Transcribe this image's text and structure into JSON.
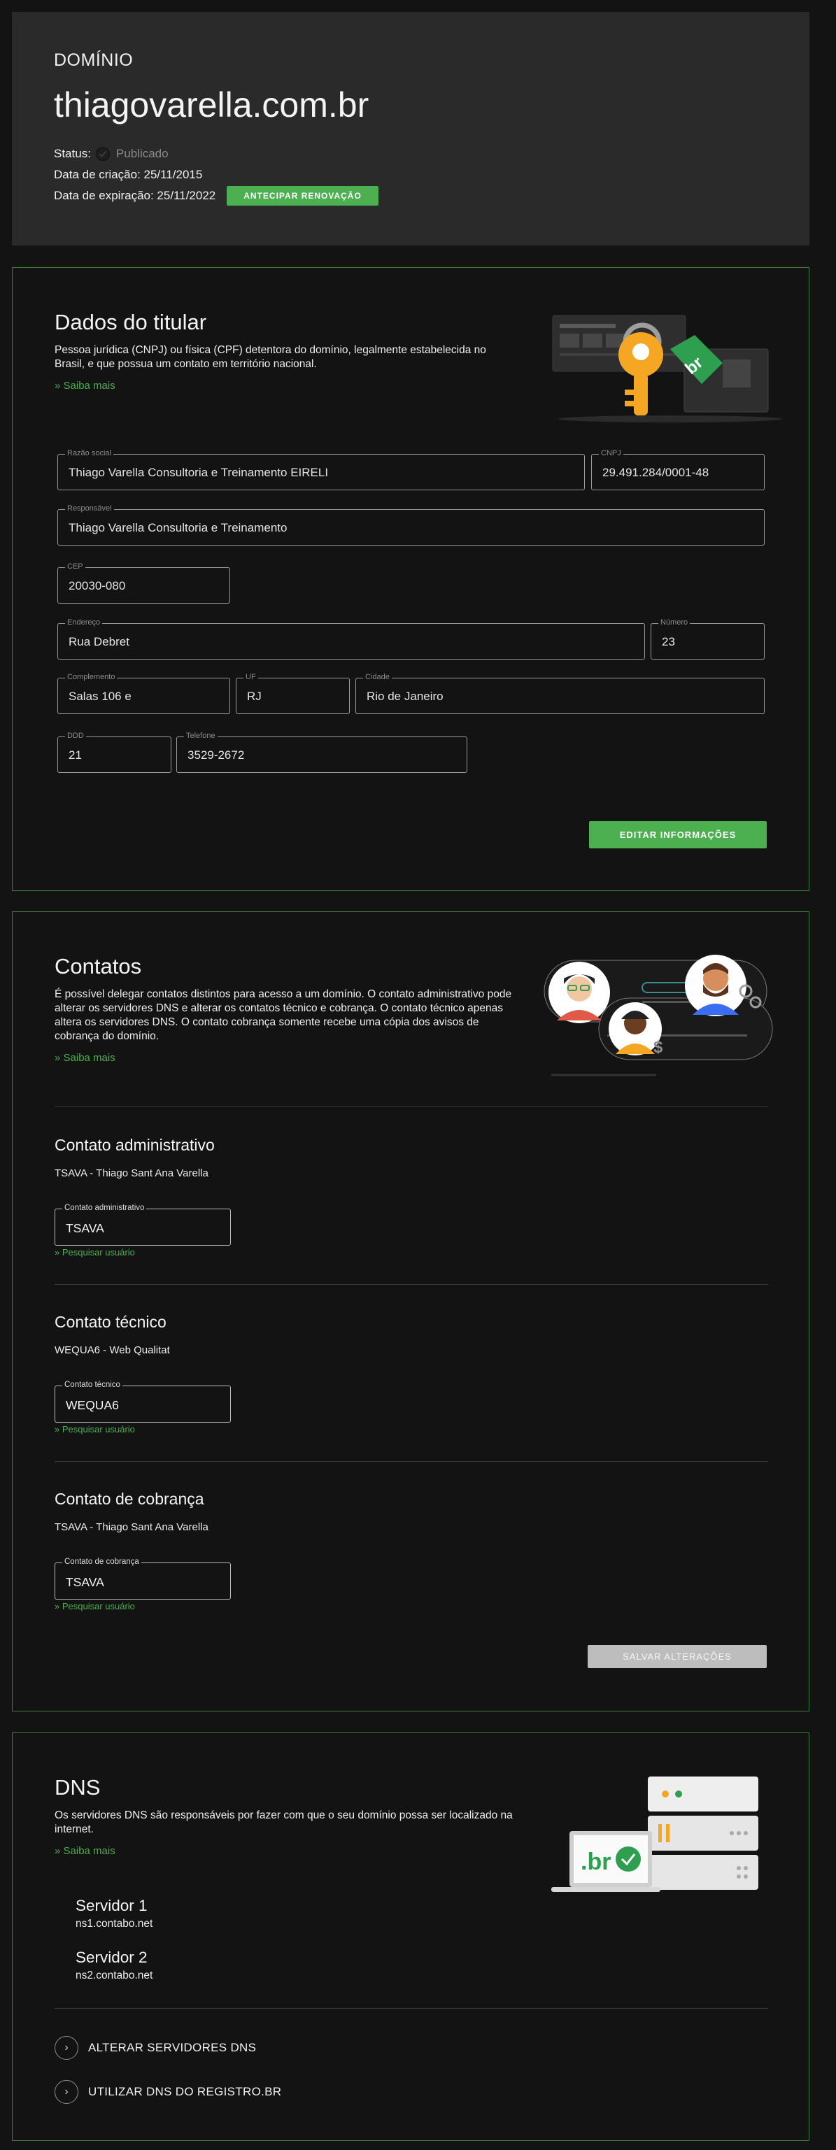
{
  "domain": {
    "eyebrow": "DOMÍNIO",
    "name": "thiagovarella.com.br",
    "status_label": "Status:",
    "status_value": "Publicado",
    "created_label": "Data de criação: 25/11/2015",
    "expires_label": "Data de expiração: 25/11/2022",
    "renew_button": "ANTECIPAR RENOVAÇÃO"
  },
  "holder": {
    "title": "Dados do titular",
    "description": "Pessoa jurídica (CNPJ) ou física (CPF) detentora do domínio, legalmente estabelecida no Brasil, e que possua um contato em território nacional.",
    "more_link": "» Saiba mais",
    "fields": {
      "razao_label": "Razão social",
      "razao_value": "Thiago Varella Consultoria e Treinamento EIRELI",
      "cnpj_label": "CNPJ",
      "cnpj_value": "29.491.284/0001-48",
      "resp_label": "Responsável",
      "resp_value": "Thiago Varella Consultoria e Treinamento",
      "cep_label": "CEP",
      "cep_value": "20030-080",
      "endereco_label": "Endereço",
      "endereco_value": "Rua Debret",
      "numero_label": "Número",
      "numero_value": "23",
      "complemento_label": "Complemento",
      "complemento_value": "Salas 106 e",
      "uf_label": "UF",
      "uf_value": "RJ",
      "cidade_label": "Cidade",
      "cidade_value": "Rio de Janeiro",
      "ddd_label": "DDD",
      "ddd_value": "21",
      "telefone_label": "Telefone",
      "telefone_value": "3529-2672"
    },
    "edit_button": "EDITAR INFORMAÇÕES"
  },
  "contacts": {
    "title": "Contatos",
    "description": "É possível delegar contatos distintos para acesso a um domínio. O contato administrativo pode alterar os servidores DNS e alterar os contatos técnico e cobrança. O contato técnico apenas altera os servidores DNS. O contato cobrança somente recebe uma cópia dos avisos de cobrança do domínio.",
    "more_link": "» Saiba mais",
    "admin": {
      "title": "Contato administrativo",
      "name": "TSAVA - Thiago Sant Ana Varella",
      "field_label": "Contato administrativo",
      "field_value": "TSAVA",
      "search": "» Pesquisar usuário"
    },
    "tech": {
      "title": "Contato técnico",
      "name": "WEQUA6 - Web Qualitat",
      "field_label": "Contato técnico",
      "field_value": "WEQUA6",
      "search": "» Pesquisar usuário"
    },
    "billing": {
      "title": "Contato de cobrança",
      "name": "TSAVA - Thiago Sant Ana Varella",
      "field_label": "Contato de cobrança",
      "field_value": "TSAVA",
      "search": "» Pesquisar usuário"
    },
    "save_button": "SALVAR ALTERAÇÕES"
  },
  "dns": {
    "title": "DNS",
    "description": "Os servidores DNS são responsáveis por fazer com que o seu domínio possa ser localizado na internet.",
    "more_link": "» Saiba mais",
    "servers": [
      {
        "name": "Servidor 1",
        "host": "ns1.contabo.net"
      },
      {
        "name": "Servidor 2",
        "host": "ns2.contabo.net"
      }
    ],
    "actions": [
      "ALTERAR SERVIDORES DNS",
      "UTILIZAR DNS DO REGISTRO.BR"
    ]
  },
  "colors": {
    "accent": "#4caf50",
    "panel_border": "#3f7d3f",
    "background": "#131313",
    "header_card": "#2a2a2a"
  },
  "icons": [
    "check-circle-icon",
    "key-illustration",
    "contacts-illustration",
    "dns-server-illustration",
    "chevron-right-icon"
  ]
}
